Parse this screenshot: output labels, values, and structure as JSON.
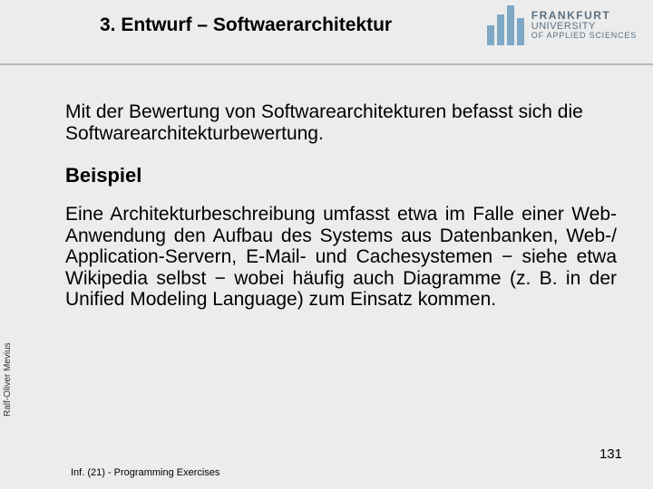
{
  "header": {
    "title": "3. Entwurf – Softwaerarchitektur",
    "logo": {
      "line1": "FRANKFURT",
      "line2": "UNIVERSITY",
      "line3": "OF APPLIED SCIENCES"
    }
  },
  "body": {
    "intro": "Mit der Bewertung von Softwarearchitekturen befasst sich die Softwarearchitekturbewertung.",
    "subheading": "Beispiel",
    "example": "Eine Architekturbeschreibung umfasst etwa im Falle einer Web-Anwendung den Aufbau des Systems aus Datenbanken, Web-/ Application-Servern, E-Mail- und Cachesystemen − siehe etwa Wikipedia selbst − wobei häufig auch Diagramme (z. B. in der Unified Modeling Language) zum Einsatz kommen."
  },
  "side_author": "Ralf-Oliver Mevius",
  "page_number": "131",
  "footer": "Inf. (21) - Programming Exercises"
}
